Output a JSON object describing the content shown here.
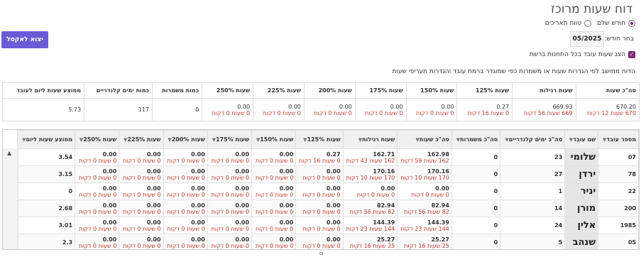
{
  "page_title": "דוח שעות מרוכז",
  "period": {
    "full_month_label": "חודש שלם",
    "date_range_label": "טווח תאריכים",
    "month_label": "בחר חודש:",
    "month_value": "05/2025"
  },
  "export_label": "יצוא לאקסל",
  "show_all_stations_label": "הצג שעות עובד בכל התחנות ברשת",
  "note": "הדוח מחושב לפי הגדרות שעות או משמרות כפי שמוגדר ברמת עובד והגדרות תעריפי שעות",
  "summary": {
    "headers": [
      "סה\"כ שעות",
      "שעות רגילות",
      "שעות 125%",
      "שעות 150%",
      "שעות 175%",
      "שעות 200%",
      "שעות 225%",
      "שעות 250%",
      "כמות משמרות",
      "כמות ימים קלנדריים",
      "ממוצע שעות ליום לעובד"
    ],
    "values": [
      {
        "main": "670.20",
        "sub": "670 שעות 12 דקות"
      },
      {
        "main": "669.93",
        "sub": "669 שעות 56 דקות"
      },
      {
        "main": "0.27",
        "sub": "0 שעות 16 דקות"
      },
      {
        "main": "0.00",
        "sub": "0 שעות 0 דקות"
      },
      {
        "main": "0.00",
        "sub": "0 שעות 0 דקות"
      },
      {
        "main": "0.00",
        "sub": "0 שעות 0 דקות"
      },
      {
        "main": "0.00",
        "sub": "0 שעות 0 דקות"
      },
      {
        "main": "0.00",
        "sub": "0 שעות 0 דקות"
      },
      {
        "main": "0",
        "sub": ""
      },
      {
        "main": "117",
        "sub": ""
      },
      {
        "main": "5.73",
        "sub": ""
      }
    ]
  },
  "detail": {
    "headers": [
      "מספר עובד",
      "שם עובד",
      "סה\"כ ימים קלנדריים",
      "סה\"כ משמרות",
      "סה\"כ שעות",
      "שעות רגילות",
      "שעות 125%",
      "שעות 150%",
      "שעות 175%",
      "שעות 200%",
      "שעות 225%",
      "שעות 250%",
      "ממוצע שעות ליום"
    ],
    "rows": [
      {
        "id": "07",
        "name": "שלומי",
        "days": "23",
        "shifts": "0",
        "total": {
          "v": "162.98",
          "r": "162 שעות 59 דקות"
        },
        "regular": {
          "v": "162.71",
          "r": "162 שעות 43 דקות"
        },
        "h125": {
          "v": "0.27",
          "r": "0 שעות 16 דקות"
        },
        "h150": {
          "v": "0.00",
          "r": "0 שעות 0 דקות"
        },
        "h175": {
          "v": "0.00",
          "r": "0 שעות 0 דקות"
        },
        "h200": {
          "v": "0.00",
          "r": "0 שעות 0 דקות"
        },
        "h225": {
          "v": "0.00",
          "r": "0 שעות 0 דקות"
        },
        "h250": {
          "v": "0.00",
          "r": "0 שעות 0 דקות"
        },
        "avg": "3.54"
      },
      {
        "id": "78",
        "name": "ירדן",
        "days": "27",
        "shifts": "0",
        "total": {
          "v": "170.16",
          "r": "170 שעות 10 דקות"
        },
        "regular": {
          "v": "170.16",
          "r": "170 שעות 10 דקות"
        },
        "h125": {
          "v": "0.00",
          "r": "0 שעות 0 דקות"
        },
        "h150": {
          "v": "0.00",
          "r": "0 שעות 0 דקות"
        },
        "h175": {
          "v": "0.00",
          "r": "0 שעות 0 דקות"
        },
        "h200": {
          "v": "0.00",
          "r": "0 שעות 0 דקות"
        },
        "h225": {
          "v": "0.00",
          "r": "0 שעות 0 דקות"
        },
        "h250": {
          "v": "0.00",
          "r": "0 שעות 0 דקות"
        },
        "avg": "3.15"
      },
      {
        "id": "22",
        "name": "יניר",
        "days": "1",
        "shifts": "0",
        "total": {
          "v": "0.00",
          "r": "0 שעות 0 דקות"
        },
        "regular": {
          "v": "0.00",
          "r": "0 שעות 0 דקות"
        },
        "h125": {
          "v": "0.00",
          "r": "0 שעות 0 דקות"
        },
        "h150": {
          "v": "0.00",
          "r": "0 שעות 0 דקות"
        },
        "h175": {
          "v": "0.00",
          "r": "0 שעות 0 דקות"
        },
        "h200": {
          "v": "0.00",
          "r": "0 שעות 0 דקות"
        },
        "h225": {
          "v": "0.00",
          "r": "0 שעות 0 דקות"
        },
        "h250": {
          "v": "0.00",
          "r": "0 שעות 0 דקות"
        },
        "avg": "0"
      },
      {
        "id": "200",
        "name": "מורן",
        "days": "14",
        "shifts": "0",
        "total": {
          "v": "82.94",
          "r": "82 שעות 56 דקות"
        },
        "regular": {
          "v": "82.94",
          "r": "82 שעות 56 דקות"
        },
        "h125": {
          "v": "0.00",
          "r": "0 שעות 0 דקות"
        },
        "h150": {
          "v": "0.00",
          "r": "0 שעות 0 דקות"
        },
        "h175": {
          "v": "0.00",
          "r": "0 שעות 0 דקות"
        },
        "h200": {
          "v": "0.00",
          "r": "0 שעות 0 דקות"
        },
        "h225": {
          "v": "0.00",
          "r": "0 שעות 0 דקות"
        },
        "h250": {
          "v": "0.00",
          "r": "0 שעות 0 דקות"
        },
        "avg": "2.68"
      },
      {
        "id": "1985",
        "name": "אלין",
        "days": "24",
        "shifts": "0",
        "total": {
          "v": "144.39",
          "r": "144 שעות 23 דקות"
        },
        "regular": {
          "v": "144.39",
          "r": "144 שעות 23 דקות"
        },
        "h125": {
          "v": "0.00",
          "r": "0 שעות 0 דקות"
        },
        "h150": {
          "v": "0.00",
          "r": "0 שעות 0 דקות"
        },
        "h175": {
          "v": "0.00",
          "r": "0 שעות 0 דקות"
        },
        "h200": {
          "v": "0.00",
          "r": "0 שעות 0 דקות"
        },
        "h225": {
          "v": "0.00",
          "r": "0 שעות 0 דקות"
        },
        "h250": {
          "v": "0.00",
          "r": "0 שעות 0 דקות"
        },
        "avg": "3.01"
      },
      {
        "id": "05",
        "name": "שנהב",
        "days": "5",
        "shifts": "0",
        "total": {
          "v": "25.27",
          "r": "25 שעות 16 דקות"
        },
        "regular": {
          "v": "25.27",
          "r": "25 שעות 16 דקות"
        },
        "h125": {
          "v": "0.00",
          "r": "0 שעות 0 דקות"
        },
        "h150": {
          "v": "0.00",
          "r": "0 שעות 0 דקות"
        },
        "h175": {
          "v": "0.00",
          "r": "0 שעות 0 דקות"
        },
        "h200": {
          "v": "0.00",
          "r": "0 שעות 0 דקות"
        },
        "h225": {
          "v": "0.00",
          "r": "0 שעות 0 דקות"
        },
        "h250": {
          "v": "0.00",
          "r": "0 שעות 0 דקות"
        },
        "avg": "2.3"
      }
    ]
  }
}
